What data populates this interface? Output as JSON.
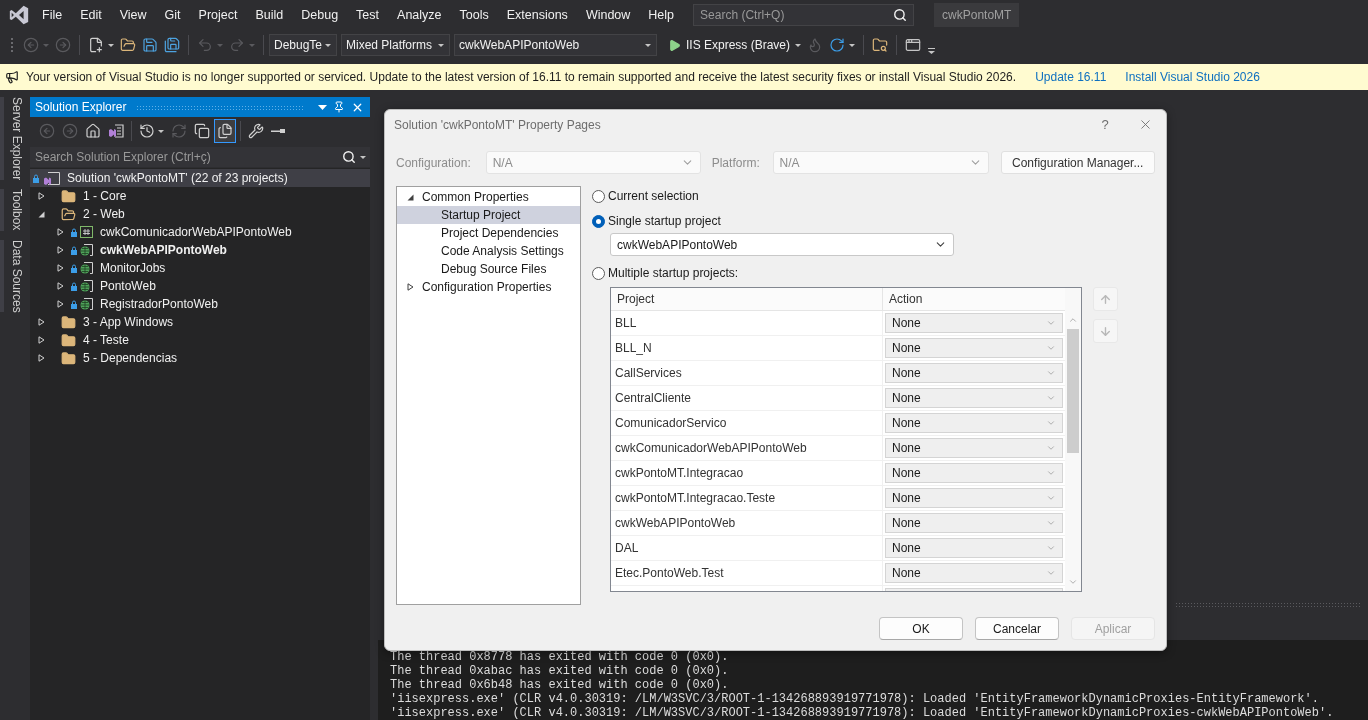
{
  "menu_bar": {
    "items": [
      "File",
      "Edit",
      "View",
      "Git",
      "Project",
      "Build",
      "Debug",
      "Test",
      "Analyze",
      "Tools",
      "Extensions",
      "Window",
      "Help"
    ],
    "search": {
      "placeholder": "Search (Ctrl+Q)"
    },
    "solution_badge": "cwkPontoMT"
  },
  "toolbar": [
    {
      "kind": "back",
      "disabled": true
    },
    {
      "kind": "forward",
      "disabled": true
    },
    {
      "kind": "separator"
    },
    {
      "kind": "new_item",
      "disabled": false
    },
    {
      "kind": "open",
      "disabled": false
    },
    {
      "kind": "save",
      "disabled": false
    },
    {
      "kind": "save_all",
      "disabled": false
    },
    {
      "kind": "separator"
    },
    {
      "kind": "undo",
      "disabled": true
    },
    {
      "kind": "redo",
      "disabled": true
    },
    {
      "kind": "separator"
    },
    {
      "kind": "combo",
      "value": "DebugTe"
    },
    {
      "kind": "combo",
      "value": "Mixed Platforms"
    },
    {
      "kind": "combo",
      "value": "cwkWebAPIPontoWeb"
    },
    {
      "kind": "run",
      "label": "IIS Express (Brave)"
    },
    {
      "kind": "hot_reload",
      "disabled": true
    },
    {
      "kind": "refresh",
      "disabled": false
    },
    {
      "kind": "separator"
    },
    {
      "kind": "find_folder",
      "disabled": false
    },
    {
      "kind": "separator"
    },
    {
      "kind": "browser",
      "disabled": false
    },
    {
      "kind": "overflow"
    }
  ],
  "banner": {
    "message": "Your version of Visual Studio is no longer supported or serviced. Update to the latest version of 16.11 to remain supported and receive the latest security fixes or install Visual Studio 2026.",
    "links": [
      "Update 16.11",
      "Install Visual Studio 2026"
    ]
  },
  "side_tabs": [
    "Server Explorer",
    "Toolbox",
    "Data Sources"
  ],
  "solution_explorer": {
    "title": "Solution Explorer",
    "toolbar": [
      {
        "kind": "back",
        "disabled": true,
        "active": false
      },
      {
        "kind": "forward",
        "disabled": true,
        "active": false
      },
      {
        "kind": "home",
        "disabled": false,
        "active": false
      },
      {
        "kind": "solution_view",
        "disabled": false,
        "active": false
      },
      {
        "kind": "separator"
      },
      {
        "kind": "history",
        "disabled": false,
        "active": false
      },
      {
        "kind": "sync",
        "disabled": true,
        "active": false
      },
      {
        "kind": "collapse",
        "disabled": false,
        "active": false
      },
      {
        "kind": "show_all",
        "disabled": false,
        "active": true
      },
      {
        "kind": "separator"
      },
      {
        "kind": "properties",
        "disabled": false,
        "active": false
      },
      {
        "kind": "preview",
        "disabled": false,
        "active": false
      }
    ],
    "search": {
      "placeholder": "Search Solution Explorer (Ctrl+ç)"
    },
    "tree": [
      {
        "kind": "solution",
        "label": "Solution 'cwkPontoMT' (22 of 23 projects)",
        "selected": true,
        "children": [
          {
            "kind": "folder",
            "label": "1 - Core",
            "expanded": false,
            "selected": false
          },
          {
            "kind": "folder",
            "label": "2 - Web",
            "expanded": true,
            "selected": false,
            "children": [
              {
                "kind": "csharp",
                "label": "cwkComunicadorWebAPIPontoWeb",
                "expanded": false,
                "selected": false,
                "startup": false
              },
              {
                "kind": "web",
                "label": "cwkWebAPIPontoWeb",
                "expanded": false,
                "selected": false,
                "startup": true
              },
              {
                "kind": "web",
                "label": "MonitorJobs",
                "expanded": false,
                "selected": false,
                "startup": false
              },
              {
                "kind": "web",
                "label": "PontoWeb",
                "expanded": false,
                "selected": false,
                "startup": false
              },
              {
                "kind": "web",
                "label": "RegistradorPontoWeb",
                "expanded": false,
                "selected": false,
                "startup": false
              }
            ]
          },
          {
            "kind": "folder",
            "label": "3 - App Windows",
            "expanded": false,
            "selected": false
          },
          {
            "kind": "folder",
            "label": "4 - Teste",
            "expanded": false,
            "selected": false
          },
          {
            "kind": "folder",
            "label": "5 - Dependencias",
            "expanded": false,
            "selected": false
          }
        ]
      }
    ]
  },
  "dialog": {
    "title": "Solution 'cwkPontoMT' Property Pages",
    "help_label": "?",
    "configuration": {
      "label": "Configuration:",
      "value": "N/A",
      "disabled": true
    },
    "platform": {
      "label": "Platform:",
      "value": "N/A",
      "disabled": true
    },
    "config_manager_button": "Configuration Manager...",
    "nav_tree": [
      {
        "label": "Common Properties",
        "expanded": true,
        "selected": false,
        "children": [
          {
            "label": "Startup Project",
            "selected": true
          },
          {
            "label": "Project Dependencies",
            "selected": false
          },
          {
            "label": "Code Analysis Settings",
            "selected": false
          },
          {
            "label": "Debug Source Files",
            "selected": false
          }
        ]
      },
      {
        "label": "Configuration Properties",
        "expanded": false,
        "selected": false
      }
    ],
    "startup_options": [
      {
        "label": "Current selection",
        "selected": false
      },
      {
        "label": "Single startup project",
        "selected": true
      },
      {
        "label": "Multiple startup projects:",
        "selected": false
      }
    ],
    "single_project": "cwkWebAPIPontoWeb",
    "table": {
      "columns": [
        "Project",
        "Action"
      ],
      "rows": [
        {
          "project": "BLL",
          "action": "None"
        },
        {
          "project": "BLL_N",
          "action": "None"
        },
        {
          "project": "CallServices",
          "action": "None"
        },
        {
          "project": "CentralCliente",
          "action": "None"
        },
        {
          "project": "ComunicadorServico",
          "action": "None"
        },
        {
          "project": "cwkComunicadorWebAPIPontoWeb",
          "action": "None"
        },
        {
          "project": "cwkPontoMT.Integracao",
          "action": "None"
        },
        {
          "project": "cwkPontoMT.Integracao.Teste",
          "action": "None"
        },
        {
          "project": "cwkWebAPIPontoWeb",
          "action": "None"
        },
        {
          "project": "DAL",
          "action": "None"
        },
        {
          "project": "Etec.PontoWeb.Test",
          "action": "None"
        }
      ]
    },
    "move_buttons": [
      {
        "kind": "up",
        "disabled": true
      },
      {
        "kind": "down",
        "disabled": true
      }
    ],
    "buttons": [
      {
        "label": "OK",
        "disabled": false
      },
      {
        "label": "Cancelar",
        "disabled": false
      },
      {
        "label": "Aplicar",
        "disabled": true
      }
    ]
  },
  "output": {
    "lines": [
      "The thread 0x8778 has exited with code 0 (0x0).",
      "The thread 0xabac has exited with code 0 (0x0).",
      "The thread 0x6b48 has exited with code 0 (0x0).",
      "'iisexpress.exe' (CLR v4.0.30319: /LM/W3SVC/3/ROOT-1-134268893919771978): Loaded 'EntityFrameworkDynamicProxies-EntityFramework'.",
      "'iisexpress.exe' (CLR v4.0.30319: /LM/W3SVC/3/ROOT-1-134268893919771978): Loaded 'EntityFrameworkDynamicProxies-cwkWebAPIPontoWeb'."
    ]
  }
}
